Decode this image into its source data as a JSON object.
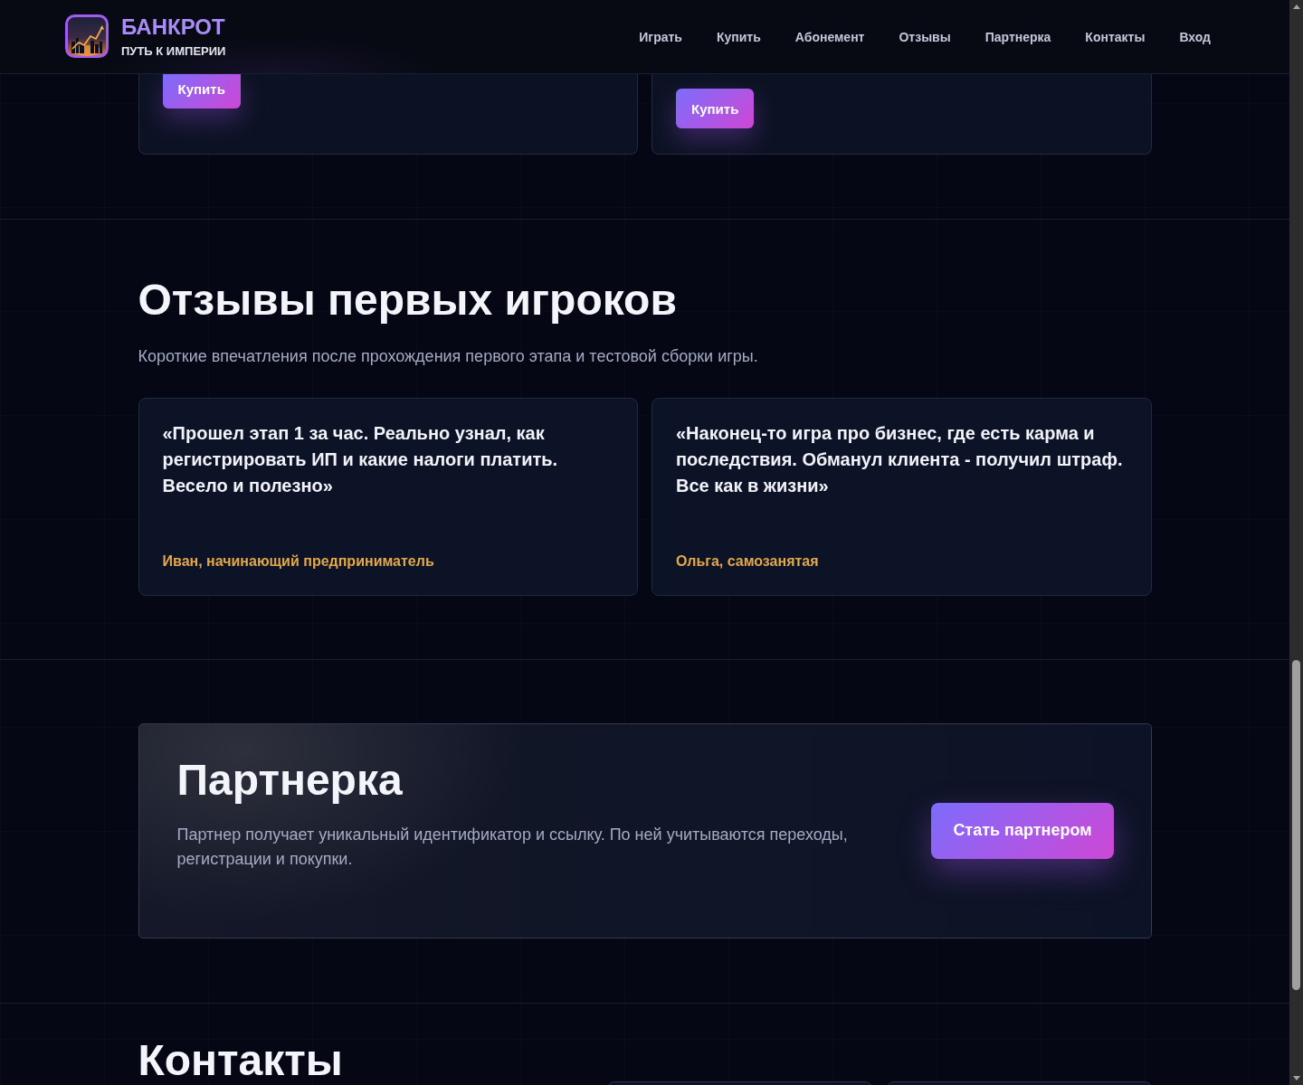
{
  "header": {
    "logo": {
      "title": "БАНКРОТ",
      "tagline": "ПУТЬ К ИМПЕРИИ"
    },
    "nav": [
      "Играть",
      "Купить",
      "Абонемент",
      "Отзывы",
      "Партнерка",
      "Контакты",
      "Вход"
    ]
  },
  "offers": [
    {
      "button": "Купить"
    },
    {
      "button": "Купить"
    }
  ],
  "reviews": {
    "title": "Отзывы первых игроков",
    "subtitle": "Короткие впечатления после прохождения первого этапа и тестовой сборки игры.",
    "items": [
      {
        "quote": "«Прошел этап 1 за час. Реально узнал, как регистрировать ИП и какие налоги платить. Весело и полезно»",
        "author": "Иван, начинающий предприниматель"
      },
      {
        "quote": "«Наконец-то игра про бизнес, где есть карма и последствия. Обманул клиента - получил штраф. Все как в жизни»",
        "author": "Ольга, самозанятая"
      }
    ]
  },
  "partner": {
    "title": "Партнерка",
    "text": "Партнер получает уникальный идентификатор и ссылку. По ней учитываются переходы, регистрации и покупки.",
    "button": "Стать партнером"
  },
  "contacts": {
    "title": "Контакты"
  }
}
